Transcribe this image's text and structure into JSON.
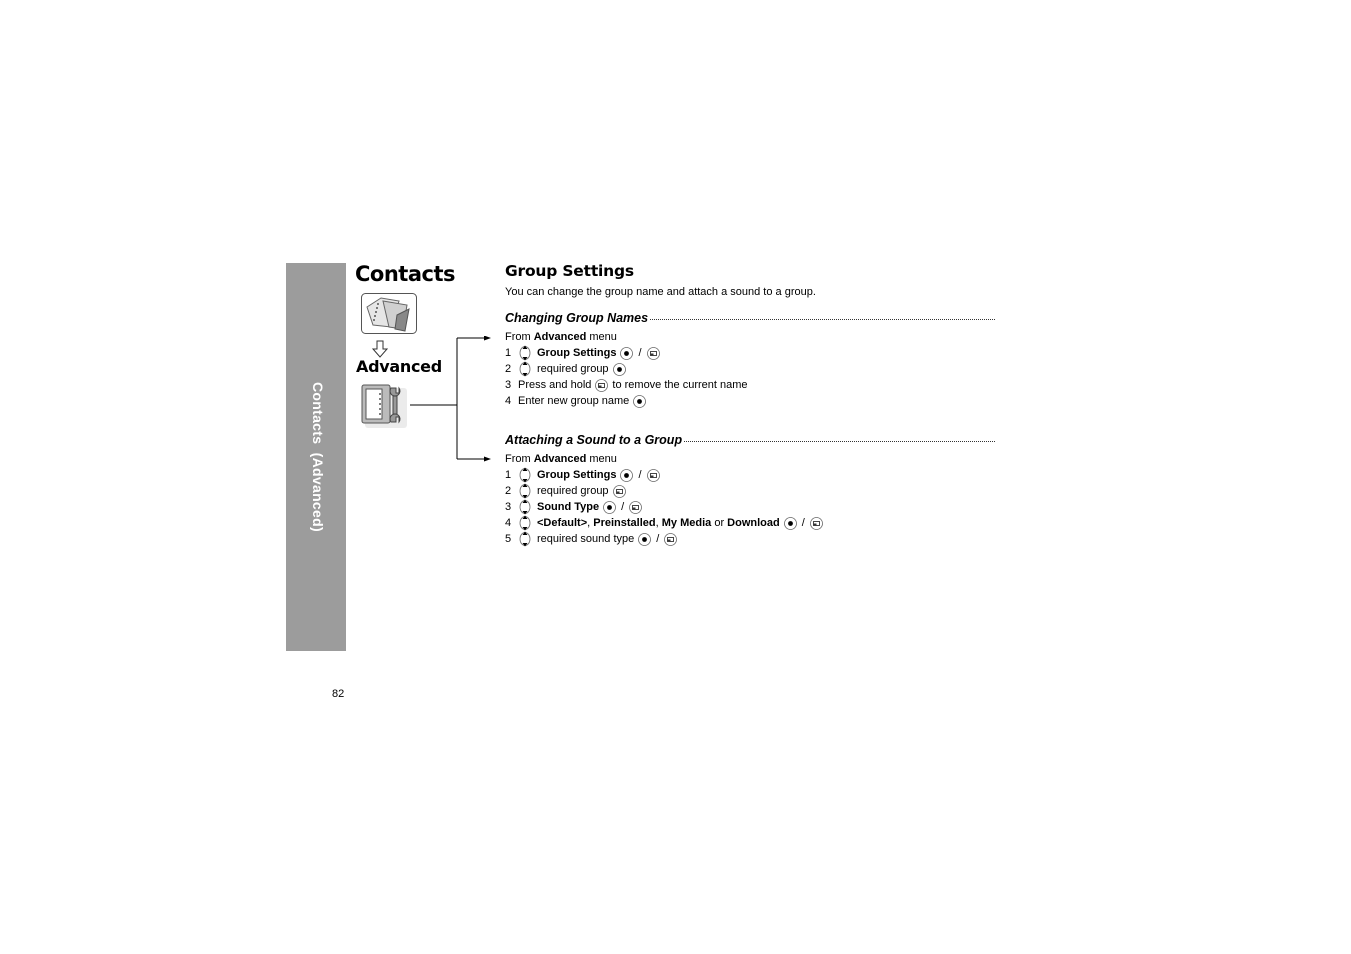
{
  "sidebar": {
    "label": "Contacts  (Advanced)",
    "color": "#9c9c9c"
  },
  "chapter": {
    "title": "Contacts",
    "icon": "contacts-folder-icon"
  },
  "submenu": {
    "title": "Advanced",
    "icon": "advanced-settings-icon",
    "arrow_icon": "down-arrow-icon"
  },
  "section": {
    "title": "Group Settings",
    "intro": "You can change the group name and attach a sound to a group."
  },
  "changing_names": {
    "heading": "Changing Group Names",
    "from": {
      "prefix": "From ",
      "bold": "Advanced",
      "suffix": " menu"
    },
    "steps": [
      {
        "num": "1",
        "parts": [
          {
            "icon": "nav-key"
          },
          {
            "bold": "Group Settings"
          },
          {
            "icon": "ok-key"
          },
          {
            "text": "/"
          },
          {
            "icon": "soft-key"
          }
        ]
      },
      {
        "num": "2",
        "parts": [
          {
            "icon": "nav-key"
          },
          {
            "text": "required group"
          },
          {
            "icon": "ok-key"
          }
        ]
      },
      {
        "num": "3",
        "parts": [
          {
            "text": "Press and hold"
          },
          {
            "icon": "soft-key"
          },
          {
            "text": "to remove the current name"
          }
        ]
      },
      {
        "num": "4",
        "parts": [
          {
            "text": "Enter new group name"
          },
          {
            "icon": "ok-key"
          }
        ]
      }
    ]
  },
  "attaching_sound": {
    "heading": "Attaching a Sound to a Group",
    "from": {
      "prefix": "From ",
      "bold": "Advanced",
      "suffix": " menu"
    },
    "steps": [
      {
        "num": "1",
        "parts": [
          {
            "icon": "nav-key"
          },
          {
            "bold": "Group Settings"
          },
          {
            "icon": "ok-key"
          },
          {
            "text": "/"
          },
          {
            "icon": "soft-key"
          }
        ]
      },
      {
        "num": "2",
        "parts": [
          {
            "icon": "nav-key"
          },
          {
            "text": "required group"
          },
          {
            "icon": "soft-key"
          }
        ]
      },
      {
        "num": "3",
        "parts": [
          {
            "icon": "nav-key"
          },
          {
            "bold": "Sound Type"
          },
          {
            "icon": "ok-key"
          },
          {
            "text": "/"
          },
          {
            "icon": "soft-key"
          }
        ]
      },
      {
        "num": "4",
        "parts": [
          {
            "icon": "nav-key"
          },
          {
            "bold": "<Default>"
          },
          {
            "text": ", "
          },
          {
            "bold": "Preinstalled"
          },
          {
            "text": ", "
          },
          {
            "bold": "My Media"
          },
          {
            "text": " or "
          },
          {
            "bold": "Download"
          },
          {
            "icon": "ok-key"
          },
          {
            "text": "/"
          },
          {
            "icon": "soft-key"
          }
        ]
      },
      {
        "num": "5",
        "parts": [
          {
            "icon": "nav-key"
          },
          {
            "text": "required sound type"
          },
          {
            "icon": "ok-key"
          },
          {
            "text": "/"
          },
          {
            "icon": "soft-key"
          }
        ]
      }
    ]
  },
  "page_number": "82"
}
